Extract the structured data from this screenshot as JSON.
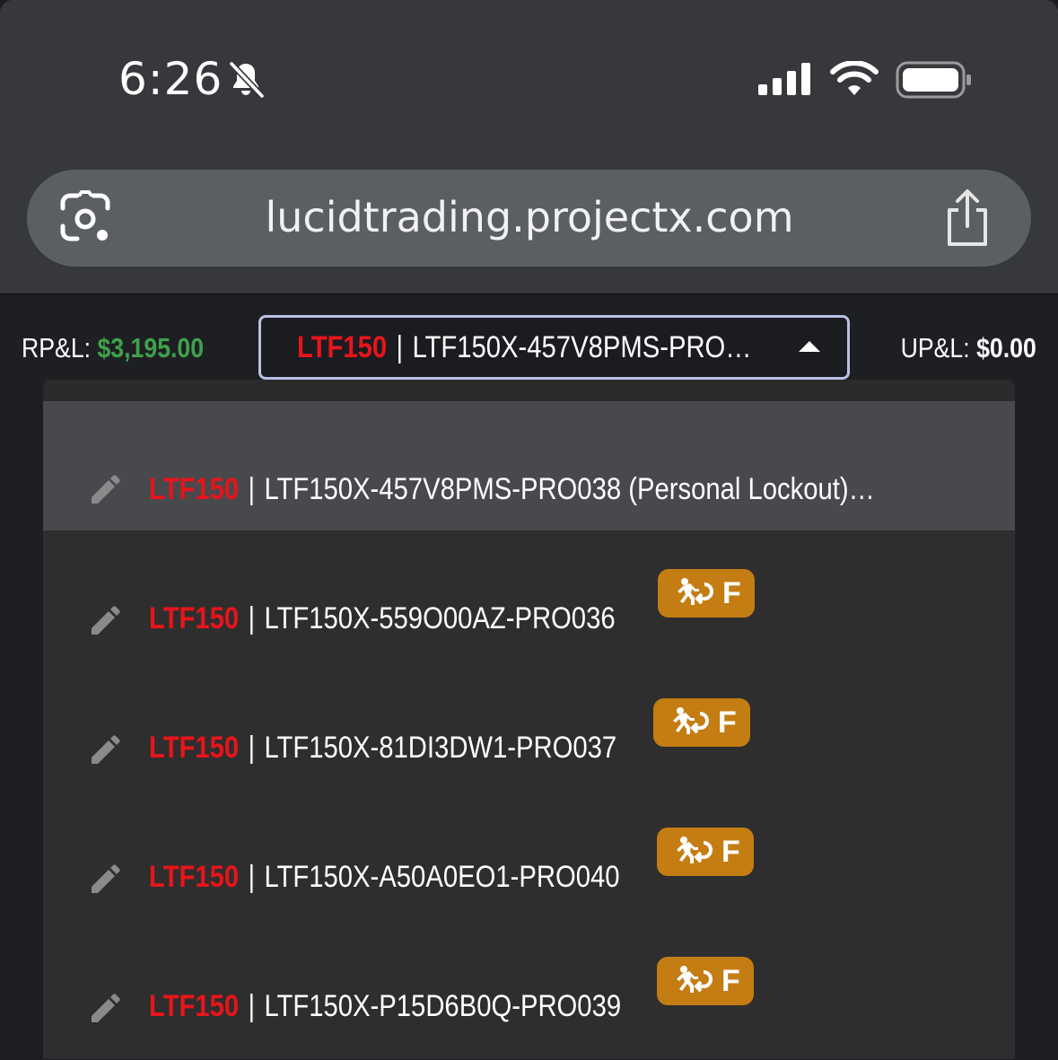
{
  "status_bar": {
    "time": "6:26",
    "icons": [
      "bell-slash-icon",
      "signal-icon",
      "wifi-icon",
      "battery-icon"
    ]
  },
  "browser": {
    "url": "lucidtrading.projectx.com",
    "icons": [
      "lens-icon",
      "share-icon"
    ]
  },
  "header": {
    "rpl_label": "RP&L:",
    "rpl_value": "$3,195.00",
    "upl_label": "UP&L:",
    "upl_value": "$0.00"
  },
  "account_select": {
    "prefix": "LTF150",
    "separator": "|",
    "value": "LTF150X-457V8PMS-PRO…",
    "icon": "caret-up-icon"
  },
  "options": [
    {
      "prefix": "LTF150",
      "separator": "|",
      "name": "LTF150X-457V8PMS-PRO038  (Personal Lockout)…",
      "badge": ""
    },
    {
      "prefix": "LTF150",
      "separator": "|",
      "name": "LTF150X-559O00AZ-PRO036",
      "badge": "F"
    },
    {
      "prefix": "LTF150",
      "separator": "|",
      "name": "LTF150X-81DI3DW1-PRO037",
      "badge": "F"
    },
    {
      "prefix": "LTF150",
      "separator": "|",
      "name": "LTF150X-A50A0EO1-PRO040",
      "badge": "F"
    },
    {
      "prefix": "LTF150",
      "separator": "|",
      "name": "LTF150X-P15D6B0Q-PRO039",
      "badge": "F"
    }
  ],
  "colors": {
    "accent_red": "#e8141b",
    "profit_green": "#3fa14a",
    "badge_orange": "#c47d12",
    "select_border": "#b8c0e6"
  }
}
